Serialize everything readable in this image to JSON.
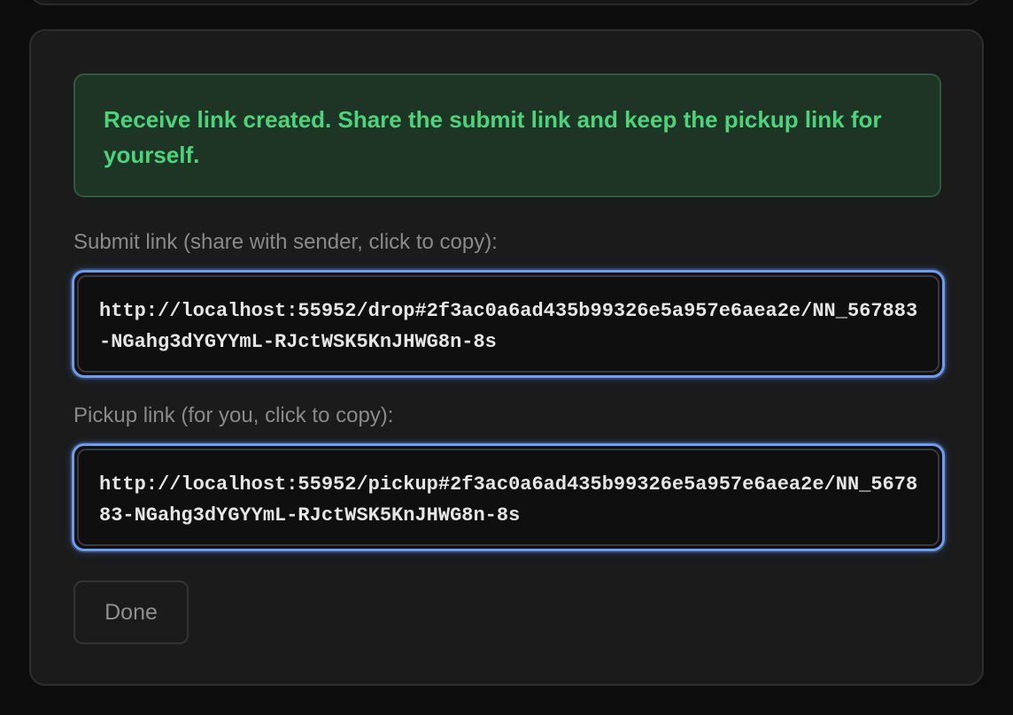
{
  "banner": {
    "message": "Receive link created. Share the submit link and keep the pickup link for yourself."
  },
  "submit": {
    "label": "Submit link (share with sender, click to copy):",
    "url": "http://localhost:55952/drop#2f3ac0a6ad435b99326e5a957e6aea2e/NN_567883-NGahg3dYGYYmL-RJctWSK5KnJHWG8n-8s"
  },
  "pickup": {
    "label": "Pickup link (for you, click to copy):",
    "url": "http://localhost:55952/pickup#2f3ac0a6ad435b99326e5a957e6aea2e/NN_567883-NGahg3dYGYYmL-RJctWSK5KnJHWG8n-8s"
  },
  "actions": {
    "done_label": "Done"
  },
  "colors": {
    "success_text": "#4ad57a",
    "focus_ring": "#6b9df0"
  }
}
